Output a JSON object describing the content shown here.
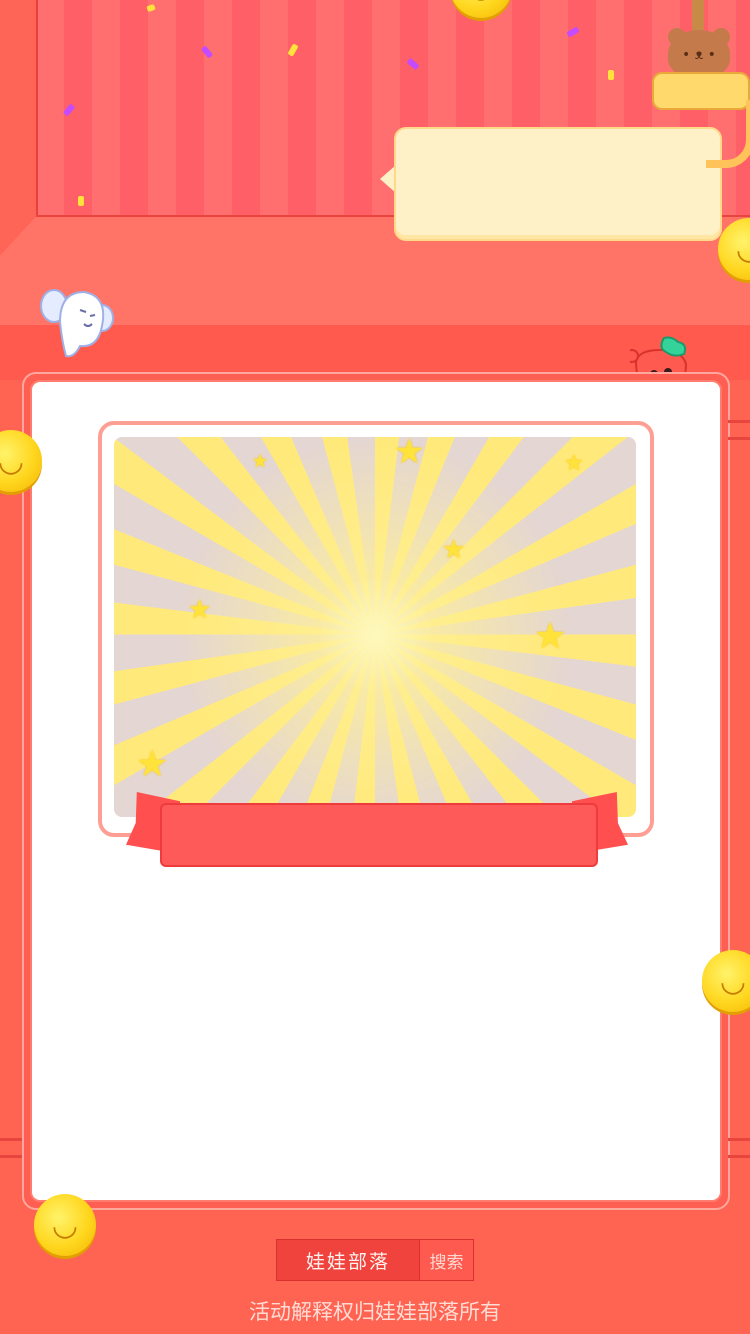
{
  "search": {
    "value": "娃娃部落",
    "button_label": "搜索"
  },
  "footer": {
    "note": "活动解释权归娃娃部落所有"
  },
  "icons": {
    "coin": "smiley-coin-icon",
    "star": "star-icon",
    "claw": "claw-machine-icon",
    "bear": "teddy-bear-icon",
    "ghost": "ghost-mascot-icon",
    "strawberry": "strawberry-mascot-icon"
  },
  "colors": {
    "background": "#ff6352",
    "card": "#ffffff",
    "ribbon": "#ff5a5a",
    "bubble": "#fff1c7",
    "coin": "#ffd61e"
  }
}
